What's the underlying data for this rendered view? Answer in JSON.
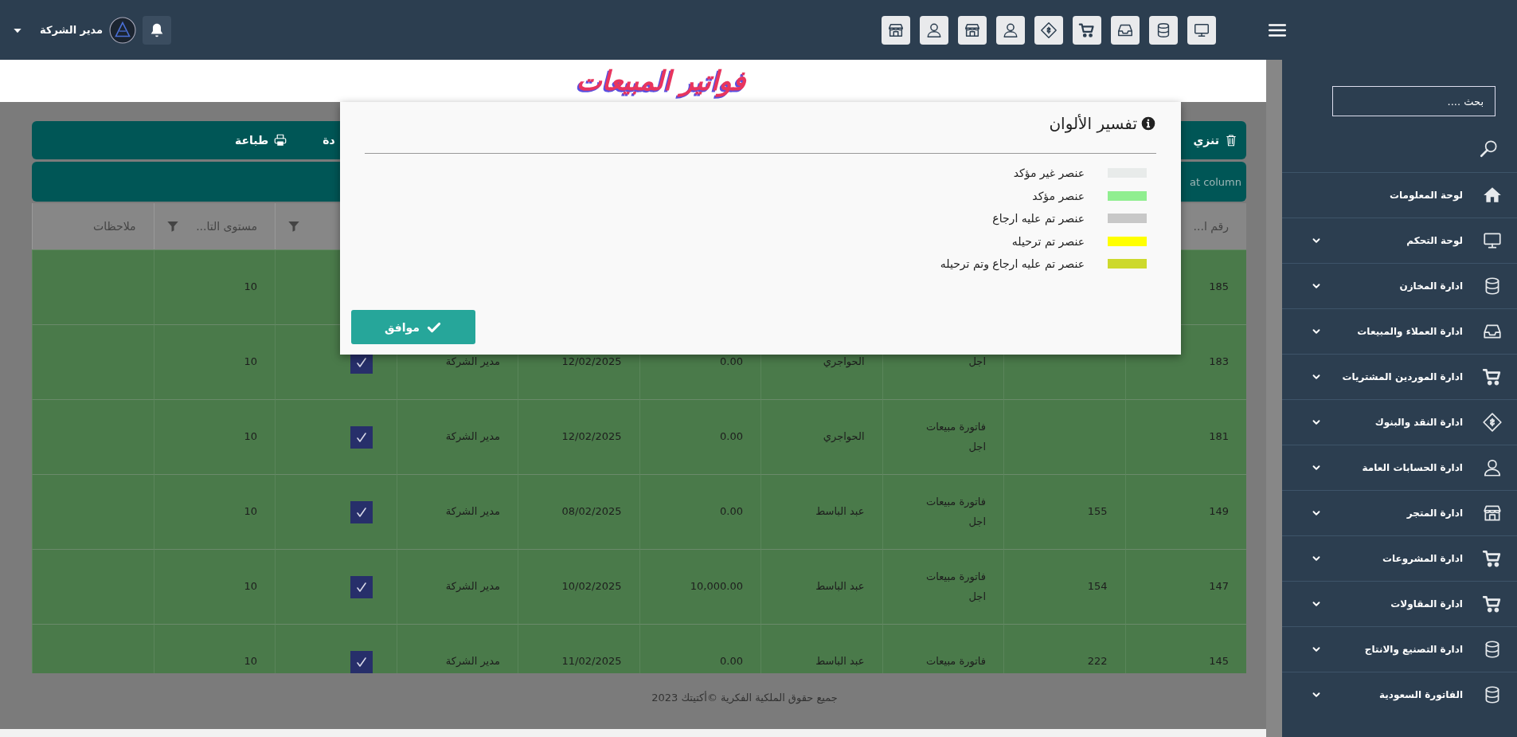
{
  "top_bar": {
    "shortcuts": [
      {
        "kind": "monitor"
      },
      {
        "kind": "database"
      },
      {
        "kind": "inbox"
      },
      {
        "kind": "cart"
      },
      {
        "kind": "money"
      },
      {
        "kind": "user"
      },
      {
        "kind": "store"
      },
      {
        "kind": "user"
      },
      {
        "kind": "store"
      }
    ],
    "user_name": "مدير الشركة"
  },
  "sidebar": {
    "search": {
      "placeholder": "بحث ...."
    },
    "items": [
      {
        "label": "لوحة المعلومات",
        "kind": "home",
        "has_submenu": false
      },
      {
        "label": "لوحة التحكم",
        "kind": "monitor",
        "has_submenu": true
      },
      {
        "label": "ادارة المخازن",
        "kind": "database",
        "has_submenu": true
      },
      {
        "label": "ادارة العملاء والمبيعات",
        "kind": "inbox",
        "has_submenu": true
      },
      {
        "label": "ادارة الموردين المشتريات",
        "kind": "cart",
        "has_submenu": true
      },
      {
        "label": "ادارة النقد والبنوك",
        "kind": "money",
        "has_submenu": true
      },
      {
        "label": "ادارة الحسابات العامة",
        "kind": "user",
        "has_submenu": true
      },
      {
        "label": "ادارة المتجر",
        "kind": "store",
        "has_submenu": true
      },
      {
        "label": "ادارة المشروعات",
        "kind": "cart",
        "has_submenu": true
      },
      {
        "label": "ادارة المقاولات",
        "kind": "cart",
        "has_submenu": true
      },
      {
        "label": "ادارة التصنيع والانتاج",
        "kind": "database",
        "has_submenu": true
      },
      {
        "label": "الفاتورة السعودية",
        "kind": "database",
        "has_submenu": true
      }
    ]
  },
  "page_title": "فواتير المبيعات",
  "toolbar": {
    "right_button": {
      "label": "تنزي",
      "kind": "trash"
    },
    "left_buttons": [
      {
        "label": "دة"
      },
      {
        "label": "طباعة",
        "kind": "print"
      }
    ]
  },
  "grid_bar": {
    "text": "at column"
  },
  "table": {
    "columns": [
      {
        "label": "رقم ا..."
      },
      {},
      {},
      {},
      {},
      {},
      {},
      {
        "filter": true
      },
      {
        "label": "مستوى التا...",
        "filter": true
      },
      {
        "label": "ملاحظات",
        "filter": false
      }
    ],
    "rows": [
      {
        "number": "185",
        "level": "10"
      },
      {
        "number": "183",
        "type": "اجل",
        "customer": "الحواجري",
        "amount": "0.00",
        "date": "12/02/2025",
        "user": "مدير الشركة",
        "confirmed": true,
        "level": "10"
      },
      {
        "number": "181",
        "type": "فاتورة مبيعات\nاجل",
        "customer": "الحواجري",
        "amount": "0.00",
        "date": "12/02/2025",
        "user": "مدير الشركة",
        "confirmed": true,
        "level": "10"
      },
      {
        "number": "149",
        "ref": "155",
        "type": "فاتورة مبيعات\nاجل",
        "customer": "عبد الباسط",
        "amount": "0.00",
        "date": "08/02/2025",
        "user": "مدير الشركة",
        "confirmed": true,
        "level": "10"
      },
      {
        "number": "147",
        "ref": "154",
        "type": "فاتورة مبيعات\nاجل",
        "customer": "عبد الباسط",
        "amount": "10,000.00",
        "date": "10/02/2025",
        "user": "مدير الشركة",
        "confirmed": true,
        "level": "10"
      },
      {
        "number": "145",
        "ref": "222",
        "type": "فاتورة مبيعات",
        "customer": "عبد الباسط",
        "amount": "0.00",
        "date": "11/02/2025",
        "user": "مدير الشركة",
        "confirmed": true,
        "level": "10"
      }
    ]
  },
  "footer": "جميع حقوق الملكية الفكرية ©أكتيتك 2023",
  "dialog": {
    "title": "تفسير الألوان",
    "legend": [
      {
        "label": "عنصر غير مؤكد",
        "color": "#e8ebea"
      },
      {
        "label": "عنصر مؤكد",
        "color": "#90ee90"
      },
      {
        "label": "عنصر تم عليه ارجاع",
        "color": "#c8c8c8"
      },
      {
        "label": "عنصر تم ترحيله",
        "color": "#ffff00"
      },
      {
        "label": "عنصر تم عليه ارجاع وتم ترحيله",
        "color": "#cdd92c"
      }
    ],
    "ok_button": "موافق"
  }
}
